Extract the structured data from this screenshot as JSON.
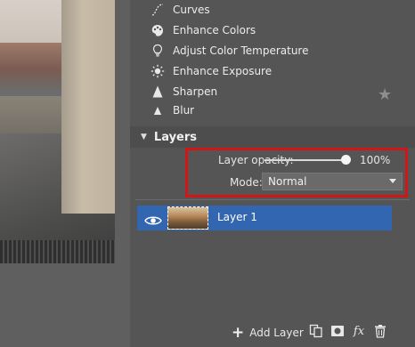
{
  "menu": {
    "items": [
      {
        "label": "Curves",
        "icon": "curves-icon"
      },
      {
        "label": "Enhance Colors",
        "icon": "palette-icon"
      },
      {
        "label": "Adjust Color Temperature",
        "icon": "lightbulb-icon"
      },
      {
        "label": "Enhance Exposure",
        "icon": "sun-icon"
      },
      {
        "label": "Sharpen",
        "icon": "triangle-icon"
      },
      {
        "label": "Blur",
        "icon": "triangle-icon"
      }
    ]
  },
  "layers_panel": {
    "title": "Layers",
    "opacity_label": "Layer opacity:",
    "opacity_value": "100%",
    "opacity_fraction": 1.0,
    "mode_label": "Mode:",
    "mode_value": "Normal",
    "layers": [
      {
        "name": "Layer 1",
        "visible": true,
        "selected": true
      }
    ],
    "add_layer_label": "Add Layer"
  },
  "colors": {
    "selection": "#3366b0",
    "highlight_box": "#d01616",
    "panel_bg": "#555555"
  }
}
